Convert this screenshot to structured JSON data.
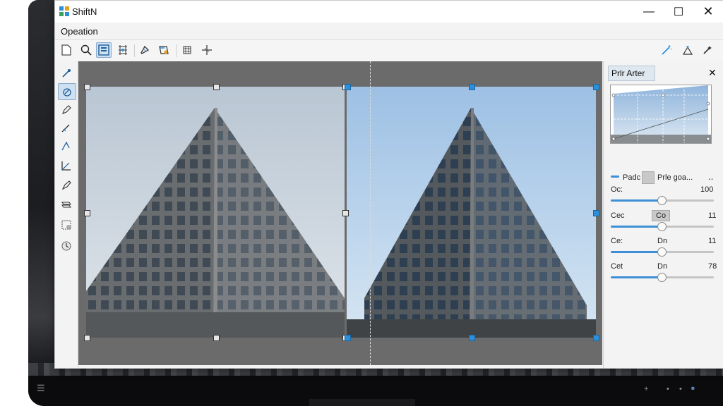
{
  "app": {
    "title": "ShiftN"
  },
  "menu": {
    "items": [
      "Opeation"
    ]
  },
  "toolbar": {
    "left_icons": [
      "new-document-icon",
      "zoom-icon",
      "fit-view-icon",
      "grid-points-icon",
      "rotate-icon",
      "perspective-icon",
      "crop-grid-icon",
      "crosshair-icon"
    ],
    "right_icons": [
      "magic-wand-icon",
      "auto-correct-icon",
      "settings-sparkle-icon"
    ]
  },
  "left_tools": [
    "eyedropper-icon",
    "transform-icon",
    "pen-icon",
    "edit-line-icon",
    "angle-icon",
    "corner-icon",
    "marker-icon",
    "layers-icon",
    "grid-tool-icon",
    "history-icon"
  ],
  "panel": {
    "tab_label": "Prlr Arter",
    "close_icon": "close-icon",
    "mode_label": "Padc",
    "mode_value": "Prle goa...",
    "mode_more": "‥",
    "sliders": [
      {
        "label": "Oc:",
        "mid": "",
        "value": "100",
        "level": 0.49
      },
      {
        "label": "Cec",
        "mid": "Co",
        "value": "11",
        "level": 0.49
      },
      {
        "label": "Ce:",
        "mid": "Dn",
        "value": "11",
        "level": 0.49
      },
      {
        "label": "Cet",
        "mid": "Dn",
        "value": "78",
        "level": 0.49
      }
    ]
  },
  "colors": {
    "accent": "#2e8fd8",
    "canvas": "#6b6b6b",
    "sky_before": "#c9d3de",
    "sky_after": "#a9cae8"
  },
  "taskbar": {
    "icons": [
      "start-icon",
      "up-arrow-icon",
      "dot-icon",
      "lock-icon",
      "info-icon"
    ]
  }
}
